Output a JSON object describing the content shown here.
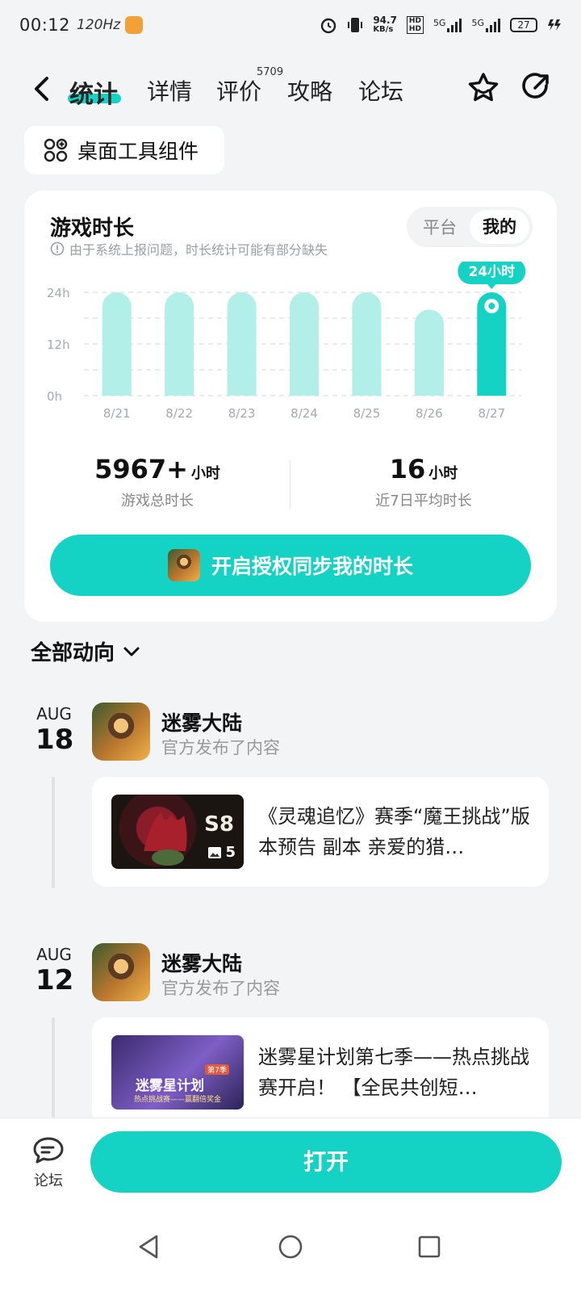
{
  "status_bar": {
    "time": "00:12",
    "refresh_rate": "120Hz",
    "net_speed": "94.7",
    "net_unit": "KB/s",
    "battery": "27",
    "network_1": "5G",
    "network_2": "5G"
  },
  "nav": {
    "tabs": [
      "统计",
      "详情",
      "评价",
      "攻略",
      "论坛"
    ],
    "review_count": "5709"
  },
  "widget_button": "桌面工具组件",
  "playtime": {
    "title": "游戏时长",
    "note": "由于系统上报问题，时长统计可能有部分缺失",
    "toggle": [
      "平台",
      "我的"
    ],
    "highlight_label": "24小时",
    "total_value": "5967+",
    "total_unit": "小时",
    "total_label": "游戏总时长",
    "avg_value": "16",
    "avg_unit": "小时",
    "avg_label": "近7日平均时长",
    "sync_button": "开启授权同步我的时长"
  },
  "chart_data": {
    "type": "bar",
    "categories": [
      "8/21",
      "8/22",
      "8/23",
      "8/24",
      "8/25",
      "8/26",
      "8/27"
    ],
    "values": [
      24,
      24,
      24,
      24,
      24,
      20,
      24
    ],
    "ylim": [
      0,
      24
    ],
    "yticks": [
      "0h",
      "12h",
      "24h"
    ],
    "highlight_index": 6,
    "grid": true,
    "colors": {
      "bar": "#b2efe9",
      "highlight": "#14d3c4"
    }
  },
  "feed": {
    "section_title": "全部动向",
    "items": [
      {
        "month": "AUG",
        "day": "18",
        "name": "迷雾大陆",
        "action": "官方发布了内容",
        "post_text": "《灵魂追忆》赛季“魔王挑战”版本预告 副本 亲爱的猎…",
        "image_count": "5",
        "thumb_label": "S8"
      },
      {
        "month": "AUG",
        "day": "12",
        "name": "迷雾大陆",
        "action": "官方发布了内容",
        "post_text": "迷雾星计划第七季——热点挑战赛开启！ 【全民共创短…",
        "thumb_label": "迷雾星计划",
        "thumb_sub": "热点挑战赛——赢翻倍奖金",
        "thumb_badge": "第7季"
      }
    ]
  },
  "bottom": {
    "forum_label": "论坛",
    "open_button": "打开"
  }
}
